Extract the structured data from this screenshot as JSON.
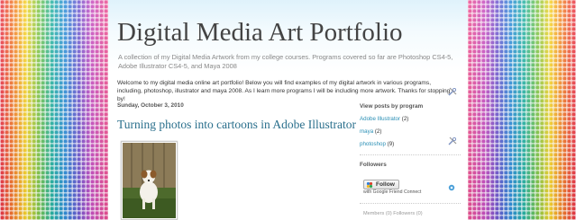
{
  "header": {
    "title": "Digital Media Art Portfolio",
    "description": "A collection of my Digital Media Artwork from my college courses. Programs covered so far are Photoshop CS4-5, Adobe Illustrator CS4-5, and Maya 2008"
  },
  "intro": {
    "text": "Welcome to my digital media online art portfolio! Below you will find examples of my digital artwork in various programs, including, photoshop, illustrator and maya 2008. As I learn more programs I will be including more artwork. Thanks for stopping by!"
  },
  "post": {
    "date": "Sunday, October 3, 2010",
    "title": "Turning photos into cartoons in Adobe Illustrator"
  },
  "sidebar": {
    "labels_heading": "View posts by program",
    "labels": [
      {
        "name": "Adobe Illustrator",
        "count": "(2)"
      },
      {
        "name": "maya",
        "count": "(2)"
      },
      {
        "name": "photoshop",
        "count": "(9)"
      }
    ],
    "followers_heading": "Followers",
    "follow_button": "Follow",
    "follow_sub": "with Google Friend Connect",
    "followers_count": "Members (0) Followers (0)"
  },
  "icons": {
    "edit": "screwdriver-wrench-icon",
    "gfc": "google-friend-connect-icon"
  },
  "colors": {
    "link": "#2a8fb5",
    "post_title": "#2a6f8c",
    "header_gradient_top": "#dff2fb"
  }
}
